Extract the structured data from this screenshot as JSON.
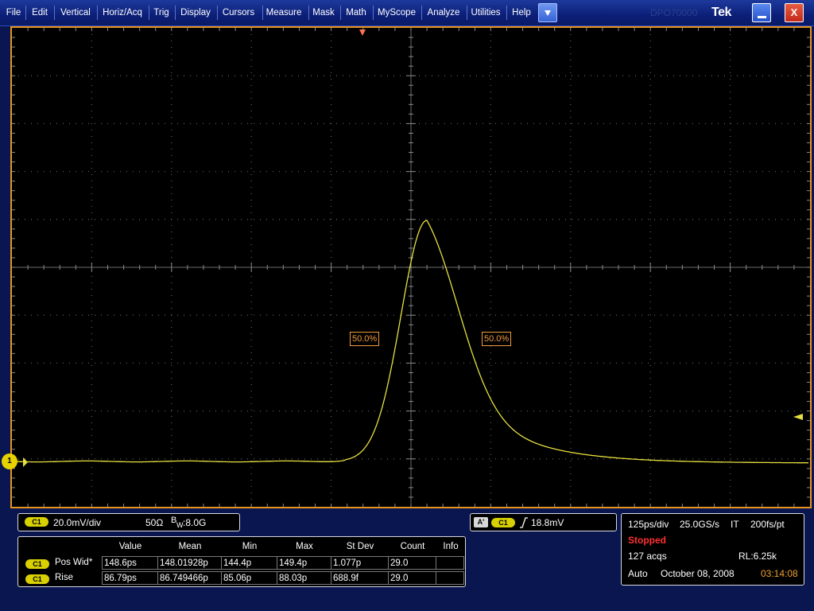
{
  "menu": {
    "items": [
      "File",
      "Edit",
      "Vertical",
      "Horiz/Acq",
      "Trig",
      "Display",
      "Cursors",
      "Measure",
      "Mask",
      "Math",
      "MyScope",
      "Analyze",
      "Utilities",
      "Help"
    ],
    "brand_ghost": "DPO70000",
    "brand": "Tek",
    "close_glyph": "X"
  },
  "display": {
    "channel_marker": "1",
    "ref_left": "50.0%",
    "ref_right": "50.0%"
  },
  "channel_panel": {
    "badge": "C1",
    "scale": "20.0mV/div",
    "impedance": "50Ω",
    "bw_b": "B",
    "bw_w": "W",
    "bw_value": ":8.0G"
  },
  "trigger_panel": {
    "mode_badge": "A'",
    "badge": "C1",
    "level": "18.8mV"
  },
  "timebase_panel": {
    "scale": "125ps/div",
    "sample_rate": "25.0GS/s",
    "mode": "IT",
    "resolution": "200fs/pt",
    "state": "Stopped",
    "acqs": "127 acqs",
    "record_length": "RL:6.25k",
    "trigger_mode": "Auto",
    "date": "October 08, 2008",
    "time": "03:14:08"
  },
  "measurements": {
    "headers": [
      "Value",
      "Mean",
      "Min",
      "Max",
      "St Dev",
      "Count",
      "Info"
    ],
    "rows": [
      {
        "badge": "C1",
        "name": "Pos Wid*",
        "value": "148.6ps",
        "mean": "148.01928p",
        "min": "144.4p",
        "max": "149.4p",
        "stdev": "1.077p",
        "count": "29.0",
        "info": ""
      },
      {
        "badge": "C1",
        "name": "Rise",
        "value": "86.79ps",
        "mean": "86.749466p",
        "min": "85.06p",
        "max": "88.03p",
        "stdev": "688.9f",
        "count": "29.0",
        "info": ""
      }
    ]
  },
  "colors": {
    "waveform": "#e6e040",
    "graticule_frame": "#e8931e",
    "reference_marker": "#f09a3a",
    "stopped": "#ff3030",
    "time_readout": "#f0a030"
  }
}
